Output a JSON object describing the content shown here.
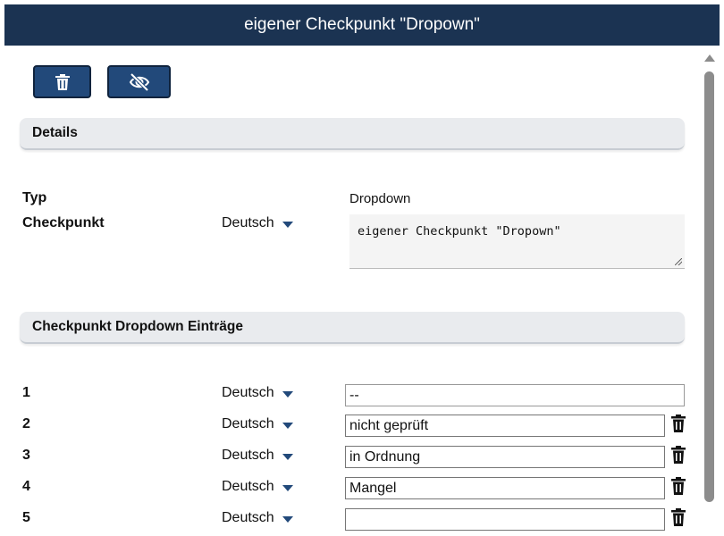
{
  "window": {
    "title": "eigener Checkpunkt \"Dropown\""
  },
  "toolbar": {
    "delete_icon": "trash-icon",
    "hide_icon": "eye-slash-icon"
  },
  "details": {
    "heading": "Details",
    "type_label": "Typ",
    "type_value": "Dropdown",
    "checkpoint_label": "Checkpunkt",
    "checkpoint_language": "Deutsch",
    "checkpoint_text": "eigener Checkpunkt \"Dropown\""
  },
  "entries": {
    "heading": "Checkpunkt Dropdown Einträge",
    "rows": [
      {
        "num": "1",
        "language": "Deutsch",
        "value": "--"
      },
      {
        "num": "2",
        "language": "Deutsch",
        "value": "nicht geprüft"
      },
      {
        "num": "3",
        "language": "Deutsch",
        "value": "in Ordnung"
      },
      {
        "num": "4",
        "language": "Deutsch",
        "value": "Mangel"
      },
      {
        "num": "5",
        "language": "Deutsch",
        "value": ""
      }
    ]
  },
  "colors": {
    "titlebar": "#1b3352",
    "button": "#22497a",
    "section_bg": "#e9ebee"
  }
}
